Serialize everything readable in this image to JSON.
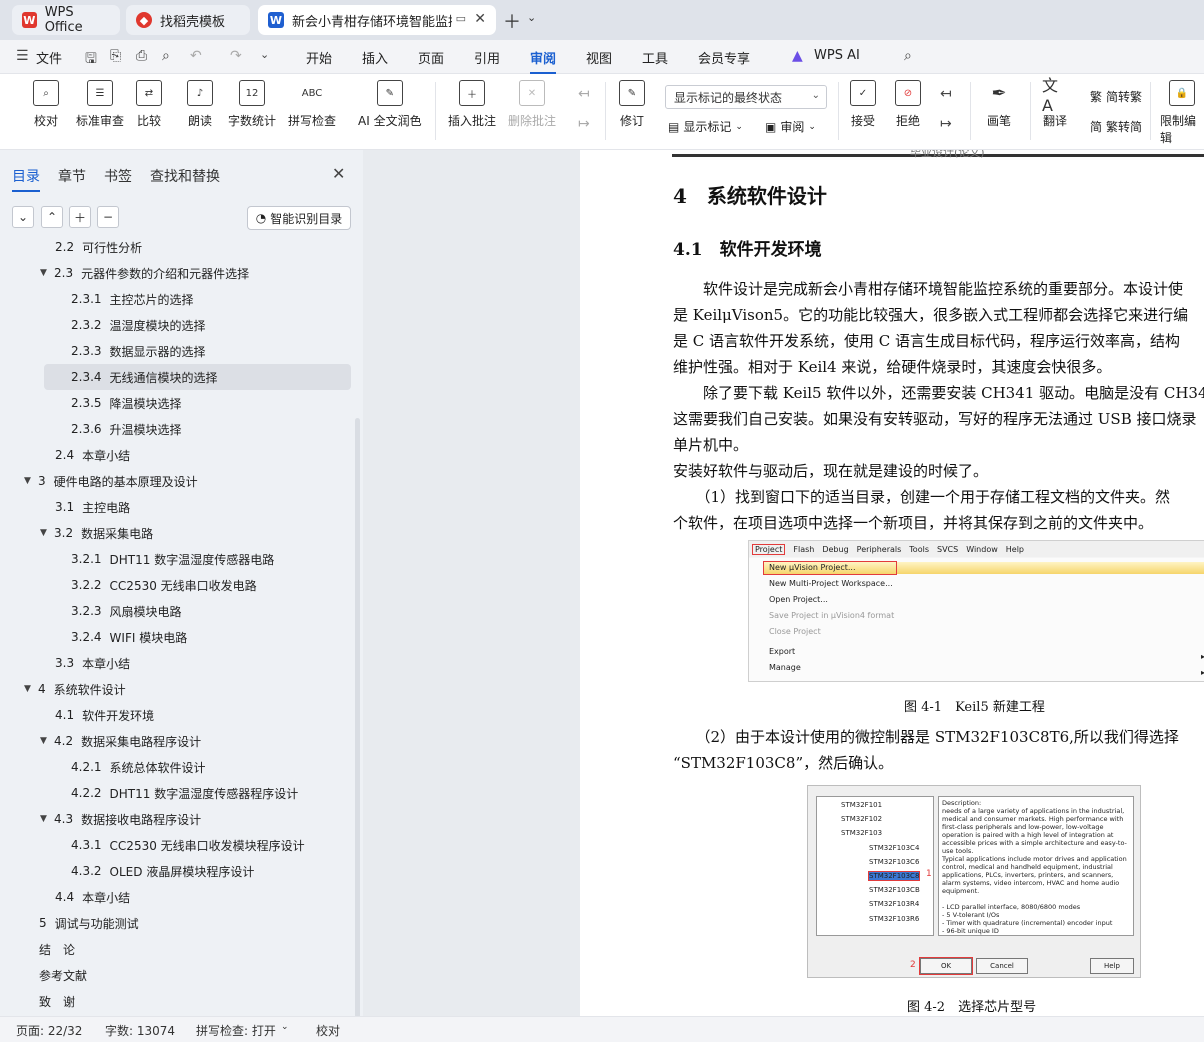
{
  "tabs": [
    {
      "label": "WPS Office",
      "icon": "wps-logo-icon",
      "color": "#e0372e"
    },
    {
      "label": "找稻壳模板",
      "icon": "docer-logo-icon",
      "color": "#e0372e"
    },
    {
      "label": "新会小青柑存储环境智能监控",
      "icon": "word-doc-icon",
      "color": "#1f5fd0"
    }
  ],
  "menu": {
    "file": "文件",
    "items": [
      "开始",
      "插入",
      "页面",
      "引用",
      "审阅",
      "视图",
      "工具",
      "会员专享"
    ],
    "active": "审阅",
    "wps_ai": "WPS AI"
  },
  "ribbon": {
    "proofread": "校对",
    "standard_review": "标准审查",
    "compare": "比较",
    "read_aloud": "朗读",
    "word_count": "字数统计",
    "spell_check": "拼写检查",
    "ai_proofread": "AI 全文润色",
    "insert_comment": "插入批注",
    "delete_comment": "删除批注",
    "track_changes": "修订",
    "show_markup_dropdown": "显示标记的最终状态",
    "show_markup": "显示标记",
    "review_pane": "审阅",
    "accept": "接受",
    "reject": "拒绝",
    "brush": "画笔",
    "translate": "翻译",
    "to_traditional": "简转繁",
    "to_simplified": "繁转简",
    "restrict_edit": "限制编辑"
  },
  "left_pane": {
    "tabs": [
      "目录",
      "章节",
      "书签",
      "查找和替换"
    ],
    "active_tab": "目录",
    "smart_toc": "智能识别目录",
    "toc": [
      {
        "num": "2.2",
        "title": "可行性分析",
        "level": 2,
        "arrow": false,
        "partial": true
      },
      {
        "num": "2.3",
        "title": "元器件参数的介绍和元器件选择",
        "level": 2,
        "arrow": true
      },
      {
        "num": "2.3.1",
        "title": "主控芯片的选择",
        "level": 3
      },
      {
        "num": "2.3.2",
        "title": "温湿度模块的选择",
        "level": 3
      },
      {
        "num": "2.3.3",
        "title": "数据显示器的选择",
        "level": 3
      },
      {
        "num": "2.3.4",
        "title": "无线通信模块的选择",
        "level": 3,
        "selected": true
      },
      {
        "num": "2.3.5",
        "title": "降温模块选择",
        "level": 3
      },
      {
        "num": "2.3.6",
        "title": "升温模块选择",
        "level": 3
      },
      {
        "num": "2.4",
        "title": "本章小结",
        "level": 2
      },
      {
        "num": "3",
        "title": "硬件电路的基本原理及设计",
        "level": 1,
        "arrow": true
      },
      {
        "num": "3.1",
        "title": "主控电路",
        "level": 2
      },
      {
        "num": "3.2",
        "title": "数据采集电路",
        "level": 2,
        "arrow": true
      },
      {
        "num": "3.2.1",
        "title": "DHT11 数字温湿度传感器电路",
        "level": 3
      },
      {
        "num": "3.2.2",
        "title": "CC2530 无线串口收发电路",
        "level": 3
      },
      {
        "num": "3.2.3",
        "title": "风扇模块电路",
        "level": 3
      },
      {
        "num": "3.2.4",
        "title": "WIFI 模块电路",
        "level": 3
      },
      {
        "num": "3.3",
        "title": "本章小结",
        "level": 2
      },
      {
        "num": "4",
        "title": "系统软件设计",
        "level": 1,
        "arrow": true
      },
      {
        "num": "4.1",
        "title": "软件开发环境",
        "level": 2
      },
      {
        "num": "4.2",
        "title": "数据采集电路程序设计",
        "level": 2,
        "arrow": true
      },
      {
        "num": "4.2.1",
        "title": "系统总体软件设计",
        "level": 3
      },
      {
        "num": "4.2.2",
        "title": "DHT11 数字温湿度传感器程序设计",
        "level": 3
      },
      {
        "num": "4.3",
        "title": "数据接收电路程序设计",
        "level": 2,
        "arrow": true
      },
      {
        "num": "4.3.1",
        "title": "CC2530 无线串口收发模块程序设计",
        "level": 3
      },
      {
        "num": "4.3.2",
        "title": "OLED 液晶屏模块程序设计",
        "level": 3
      },
      {
        "num": "4.4",
        "title": "本章小结",
        "level": 2
      },
      {
        "num": "5",
        "title": "调试与功能测试",
        "level": 1
      },
      {
        "num": "",
        "title": "结　论",
        "level": 1
      },
      {
        "num": "",
        "title": "参考文献",
        "level": 1
      },
      {
        "num": "",
        "title": "致　谢",
        "level": 1
      }
    ]
  },
  "document": {
    "header_text": "毕业设计(论文)",
    "h1": "4　系统软件设计",
    "h2": "4.1　软件开发环境",
    "paragraphs": [
      "　　软件设计是完成新会小青柑存储环境智能监控系统的重要部分。本设计使",
      "是 KeilμVison5。它的功能比较强大，很多嵌入式工程师都会选择它来进行编",
      "是 C 语言软件开发系统，使用 C 语言生成目标代码，程序运行效率高，结构",
      "维护性强。相对于 Keil4 来说，给硬件烧录时，其速度会快很多。",
      "　　除了要下载 Keil5 软件以外，还需要安装 CH341 驱动。电脑是没有 CH34",
      "这需要我们自己安装。如果没有安转驱动，写好的程序无法通过 USB 接口烧录",
      "单片机中。",
      "安装好软件与驱动后，现在就是建设的时候了。",
      "　　（1）找到窗口下的适当目录，创建一个用于存储工程文档的文件夹。然",
      "个软件，在项目选项中选择一个新项目，并将其保存到之前的文件夹中。"
    ],
    "fig1": {
      "menubar": [
        "Project",
        "Flash",
        "Debug",
        "Peripherals",
        "Tools",
        "SVCS",
        "Window",
        "Help"
      ],
      "items": [
        {
          "label": "New µVision Project...",
          "disabled": false
        },
        {
          "label": "New Multi-Project Workspace...",
          "disabled": false
        },
        {
          "label": "Open Project...",
          "disabled": false
        },
        {
          "label": "Save Project in µVision4 format",
          "disabled": true
        },
        {
          "label": "Close Project",
          "disabled": true
        },
        {
          "label": "Export",
          "disabled": false
        },
        {
          "label": "Manage",
          "disabled": false
        }
      ],
      "caption": "图 4-1　Keil5 新建工程"
    },
    "para2": [
      "　　（2）由于本设计使用的微控制器是 STM32F103C8T6,所以我们得选择",
      "“STM32F103C8”，然后确认。"
    ],
    "fig2": {
      "tree": [
        "STM32F101",
        "STM32F102",
        "STM32F103",
        "STM32F103C4",
        "STM32F103C6",
        "STM32F103C8",
        "STM32F103CB",
        "STM32F103R4",
        "STM32F103R6"
      ],
      "selected": "STM32F103C8",
      "description": "Description:\nneeds of a large variety of applications in the industrial, medical and consumer markets. High performance with first-class peripherals and low-power, low-voltage operation is paired with a high level of integration at accessible prices with a simple architecture and easy-to-use tools.\nTypical applications include motor drives and application control, medical and handheld equipment, industrial applications, PLCs, inverters, printers, and scanners, alarm systems, video intercom, HVAC and home audio equipment.\n\n- LCD parallel interface, 8080/6800 modes\n- 5 V-tolerant I/Os\n- Timer with quadrature (incremental) encoder input\n- 96-bit unique ID",
      "ok": "OK",
      "cancel": "Cancel",
      "help": "Help",
      "mark1": "1",
      "mark2": "2",
      "caption": "图 4-2　选择芯片型号"
    }
  },
  "status": {
    "page": "页面: 22/32",
    "words": "字数: 13074",
    "spell": "拼写检查: 打开",
    "proof": "校对"
  }
}
